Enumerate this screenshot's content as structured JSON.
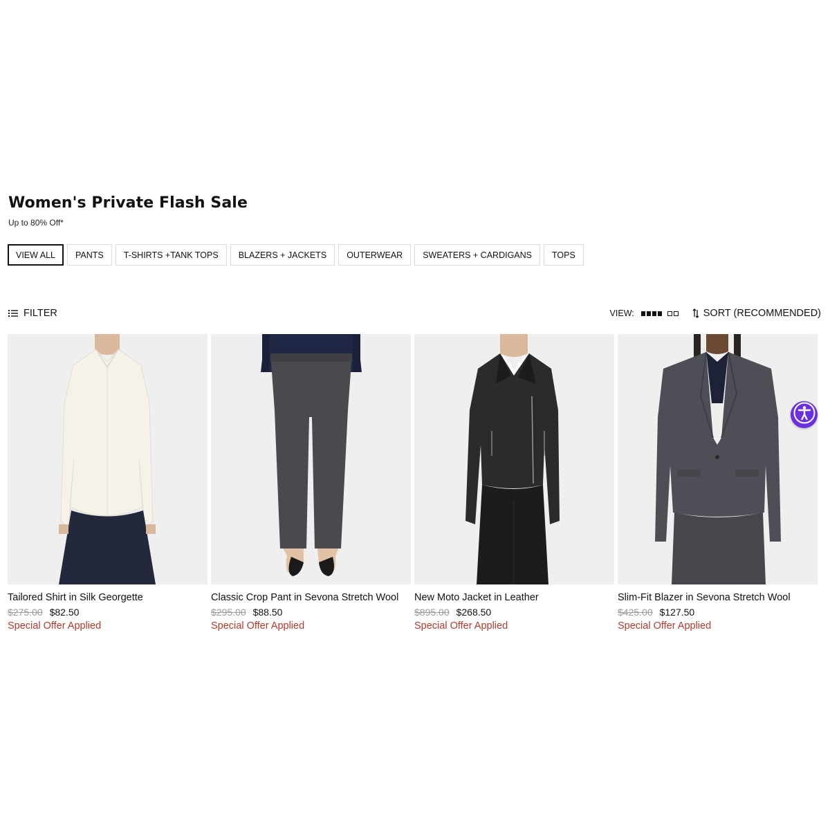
{
  "header": {
    "title": "Women's Private Flash Sale",
    "subtitle": "Up to 80% Off*"
  },
  "tabs": [
    {
      "label": "VIEW ALL",
      "active": true
    },
    {
      "label": "PANTS",
      "active": false
    },
    {
      "label": "T-SHIRTS +TANK TOPS",
      "active": false
    },
    {
      "label": "BLAZERS + JACKETS",
      "active": false
    },
    {
      "label": "OUTERWEAR",
      "active": false
    },
    {
      "label": "SWEATERS + CARDIGANS",
      "active": false
    },
    {
      "label": "TOPS",
      "active": false
    }
  ],
  "toolbar": {
    "filter_label": "FILTER",
    "filter_icon": "filter-list-icon",
    "view_label": "VIEW:",
    "grid4_icon": "grid-four-columns-icon",
    "grid2_icon": "grid-two-columns-icon",
    "sort_label": "SORT (RECOMMENDED)",
    "sort_icon": "sort-arrows-icon"
  },
  "products": [
    {
      "name": "Tailored Shirt in Silk Georgette",
      "original_price": "$275.00",
      "sale_price": "$82.50",
      "offer": "Special Offer Applied"
    },
    {
      "name": "Classic Crop Pant in Sevona Stretch Wool",
      "original_price": "$295.00",
      "sale_price": "$88.50",
      "offer": "Special Offer Applied"
    },
    {
      "name": "New Moto Jacket in Leather",
      "original_price": "$895.00",
      "sale_price": "$268.50",
      "offer": "Special Offer Applied"
    },
    {
      "name": "Slim-Fit Blazer in Sevona Stretch Wool",
      "original_price": "$425.00",
      "sale_price": "$127.50",
      "offer": "Special Offer Applied"
    }
  ],
  "accessibility": {
    "icon": "accessibility-person-icon"
  },
  "colors": {
    "offer_red": "#b03a2e",
    "accessibility_purple": "#6a2fe0",
    "image_bg": "#efefef",
    "strike_gray": "#9a9a9a"
  }
}
